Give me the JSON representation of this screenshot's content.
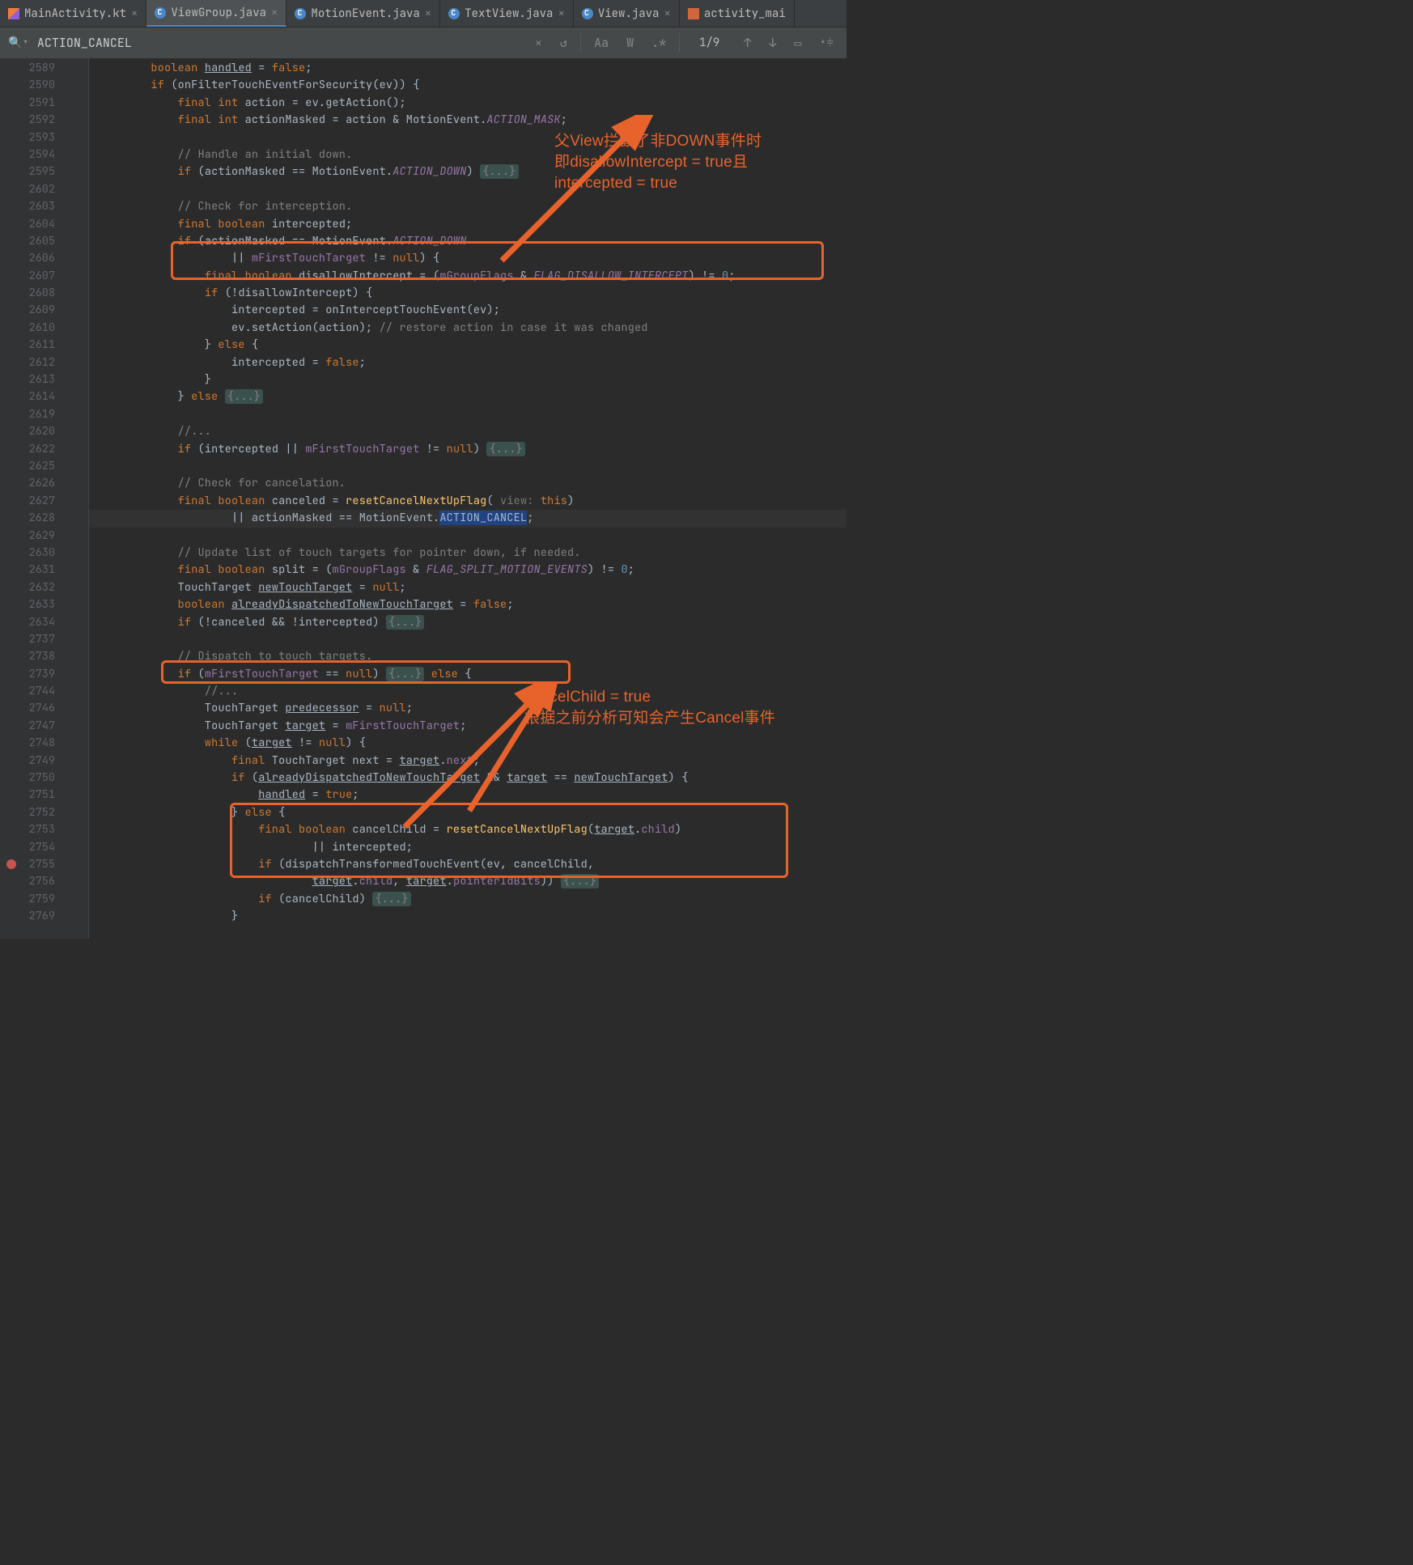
{
  "tabs": [
    {
      "label": "MainActivity.kt",
      "icon": "kt"
    },
    {
      "label": "ViewGroup.java",
      "icon": "java",
      "active": true
    },
    {
      "label": "MotionEvent.java",
      "icon": "java"
    },
    {
      "label": "TextView.java",
      "icon": "java"
    },
    {
      "label": "View.java",
      "icon": "java"
    },
    {
      "label": "activity_mai",
      "icon": "xml",
      "noclose": true
    }
  ],
  "search": {
    "query": "ACTION_CANCEL",
    "count": "1/9"
  },
  "toolbar": {
    "aa": "Aa",
    "w": "W",
    "regex": ".*"
  },
  "line_numbers": [
    "2589",
    "2590",
    "2591",
    "2592",
    "2593",
    "2594",
    "2595",
    "2602",
    "2603",
    "2604",
    "2605",
    "2606",
    "2607",
    "2608",
    "2609",
    "2610",
    "2611",
    "2612",
    "2613",
    "2614",
    "2619",
    "2620",
    "2622",
    "2625",
    "2626",
    "2627",
    "2628",
    "2629",
    "2630",
    "2631",
    "2632",
    "2633",
    "2634",
    "2737",
    "2738",
    "2739",
    "2744",
    "2746",
    "2747",
    "2748",
    "2749",
    "2750",
    "2751",
    "2752",
    "2753",
    "2754",
    "2755",
    "2756",
    "2759",
    "2769"
  ],
  "annotations": {
    "a1_l1": "父View拦截了非DOWN事件时",
    "a1_l2": "即disallowIntercept = true且",
    "a1_l3": "intercepted = true",
    "a2_l1": "cancelChild = true",
    "a2_l2": "根据之前分析可知会产生Cancel事件"
  }
}
